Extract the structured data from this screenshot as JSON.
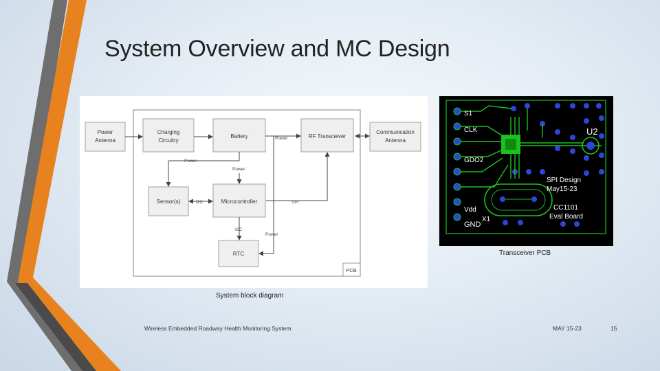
{
  "slide": {
    "title": "System Overview and MC Design",
    "diagram_caption": "System block diagram",
    "pcb_caption": "Transceiver PCB",
    "footer_left": "Wireless Embedded Roadway Health Monitoring System",
    "footer_date": "MAY 15-23",
    "page_number": "15"
  },
  "diagram": {
    "blocks": {
      "power_antenna": [
        "Power",
        "Antenna"
      ],
      "charging": [
        "Charging",
        "Circuitry"
      ],
      "battery": "Battery",
      "rf": "RF Transceiver",
      "comm_antenna": [
        "Communication",
        "Antenna"
      ],
      "sensors": "Sensor(s)",
      "mcu": "Microcontroller",
      "rtc": "RTC",
      "pcb": "PCB"
    },
    "labels": {
      "power_battery_rf": "Power",
      "power_charging": "Power",
      "power_battery_mcu": "Power",
      "i2c_sensor": "I2C",
      "spi": "SPI",
      "i2c_rtc": "I2C",
      "power_rtc": "Power"
    }
  },
  "pcb": {
    "labels": {
      "u2": "U2",
      "spi_design": "SPI Design",
      "date": "May15-23",
      "model": "CC1101",
      "eval": "Eval Board",
      "x1": "X1",
      "gnd": "GND",
      "vdd": "Vdd",
      "clk": "CLK",
      "gdo2": "GDO2",
      "s1": "S1"
    }
  },
  "colors": {
    "accent_orange": "#e8821e",
    "stripe_dark": "#3f3f3f",
    "block_fill": "#efefef",
    "pcb_trace": "#19c21f",
    "pcb_pad": "#2d46d8"
  }
}
